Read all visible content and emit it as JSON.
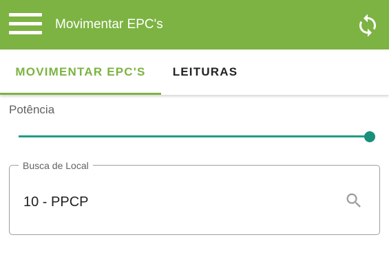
{
  "appbar": {
    "title": "Movimentar EPC's",
    "color": "#7cb342",
    "menu_icon": "hamburger-menu-icon",
    "sync_icon": "sync-icon"
  },
  "tabs": [
    {
      "label": "MOVIMENTAR EPC'S",
      "active": true
    },
    {
      "label": "LEITURAS",
      "active": false
    }
  ],
  "potencia": {
    "label": "Potência",
    "value_fraction": 1.0,
    "color": "#1f9b86"
  },
  "search": {
    "label": "Busca de Local",
    "value": "10 - PPCP",
    "icon": "search-icon"
  }
}
